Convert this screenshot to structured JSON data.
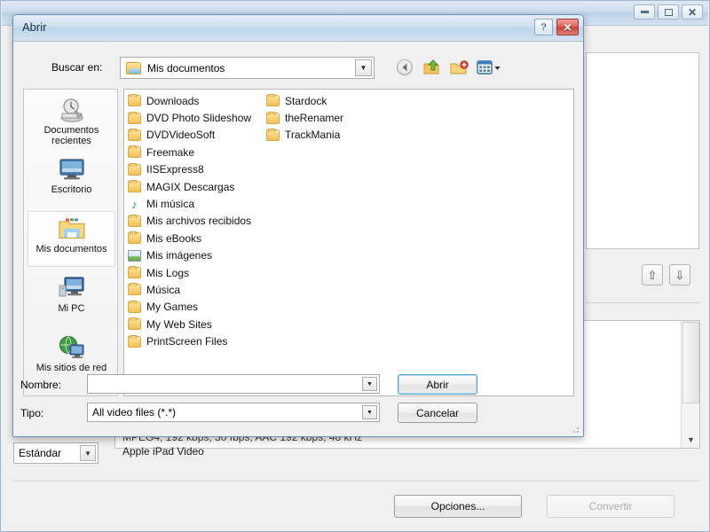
{
  "background_window": {
    "title": "",
    "window_buttons": [
      {
        "name": "minimize",
        "glyph": "minimize-icon"
      },
      {
        "name": "maximize",
        "glyph": "maximize-icon"
      },
      {
        "name": "close",
        "glyph": "close-icon"
      }
    ],
    "preset_combo": {
      "value": "Estándar"
    },
    "list_rows": [
      {
        "text": "MPEG4, 192 kbps, 30 fbps, AAC 192 kbps, 48 kHz",
        "clipped": true
      },
      {
        "text": "Apple iPad Video",
        "clipped": false
      }
    ],
    "arrow_buttons": [
      {
        "name": "move-up",
        "glyph": "⇧"
      },
      {
        "name": "move-down",
        "glyph": "⇩"
      }
    ],
    "buttons": [
      {
        "label": "Opciones...",
        "disabled": false
      },
      {
        "label": "Convertir",
        "disabled": true
      }
    ]
  },
  "dialog": {
    "title": "Abrir",
    "help_button": "?",
    "close_button": "✕",
    "look_in": {
      "label": "Buscar en:",
      "value": "Mis documentos"
    },
    "toolbar": [
      {
        "name": "back-icon",
        "tooltip": "Atrás"
      },
      {
        "name": "up-one-level-icon",
        "tooltip": "Subir un nivel"
      },
      {
        "name": "new-folder-icon",
        "tooltip": "Crear nueva carpeta"
      },
      {
        "name": "views-icon",
        "tooltip": "Vistas"
      }
    ],
    "places": [
      {
        "label": "Documentos\nrecientes",
        "icon": "recent-documents-icon",
        "selected": false
      },
      {
        "label": "Escritorio",
        "icon": "desktop-icon",
        "selected": false
      },
      {
        "label": "Mis documentos",
        "icon": "my-documents-icon",
        "selected": true
      },
      {
        "label": "Mi PC",
        "icon": "my-computer-icon",
        "selected": false
      },
      {
        "label": "Mis sitios de red",
        "icon": "network-places-icon",
        "selected": false
      }
    ],
    "file_list": {
      "column1": [
        {
          "name": "Downloads",
          "icon": "folder-icon"
        },
        {
          "name": "DVD Photo Slideshow",
          "icon": "folder-icon"
        },
        {
          "name": "DVDVideoSoft",
          "icon": "folder-icon"
        },
        {
          "name": "Freemake",
          "icon": "folder-icon"
        },
        {
          "name": "IISExpress8",
          "icon": "folder-icon"
        },
        {
          "name": "MAGIX Descargas",
          "icon": "folder-icon"
        },
        {
          "name": "Mi música",
          "icon": "music-folder-icon"
        },
        {
          "name": "Mis archivos recibidos",
          "icon": "folder-icon"
        },
        {
          "name": "Mis eBooks",
          "icon": "folder-icon"
        },
        {
          "name": "Mis imágenes",
          "icon": "pictures-folder-icon"
        },
        {
          "name": "Mis Logs",
          "icon": "folder-icon"
        },
        {
          "name": "Música",
          "icon": "folder-icon"
        },
        {
          "name": "My Games",
          "icon": "folder-icon"
        },
        {
          "name": "My Web Sites",
          "icon": "folder-icon"
        },
        {
          "name": "PrintScreen Files",
          "icon": "folder-icon"
        }
      ],
      "column2": [
        {
          "name": "Stardock",
          "icon": "folder-icon"
        },
        {
          "name": "theRenamer",
          "icon": "folder-icon"
        },
        {
          "name": "TrackMania",
          "icon": "folder-icon"
        }
      ]
    },
    "name_field": {
      "label": "Nombre:",
      "value": "",
      "placeholder": ""
    },
    "type_field": {
      "label": "Tipo:",
      "value": "All video files (*.*)"
    },
    "buttons": {
      "open": "Abrir",
      "cancel": "Cancelar"
    }
  },
  "colors": {
    "titlebar_accent": "#bcd4e8",
    "dialog_border": "#6f93b4",
    "close_red": "#c8423a",
    "default_button_focus": "#4f9fd4",
    "folder_yellow": "#f2c057"
  }
}
